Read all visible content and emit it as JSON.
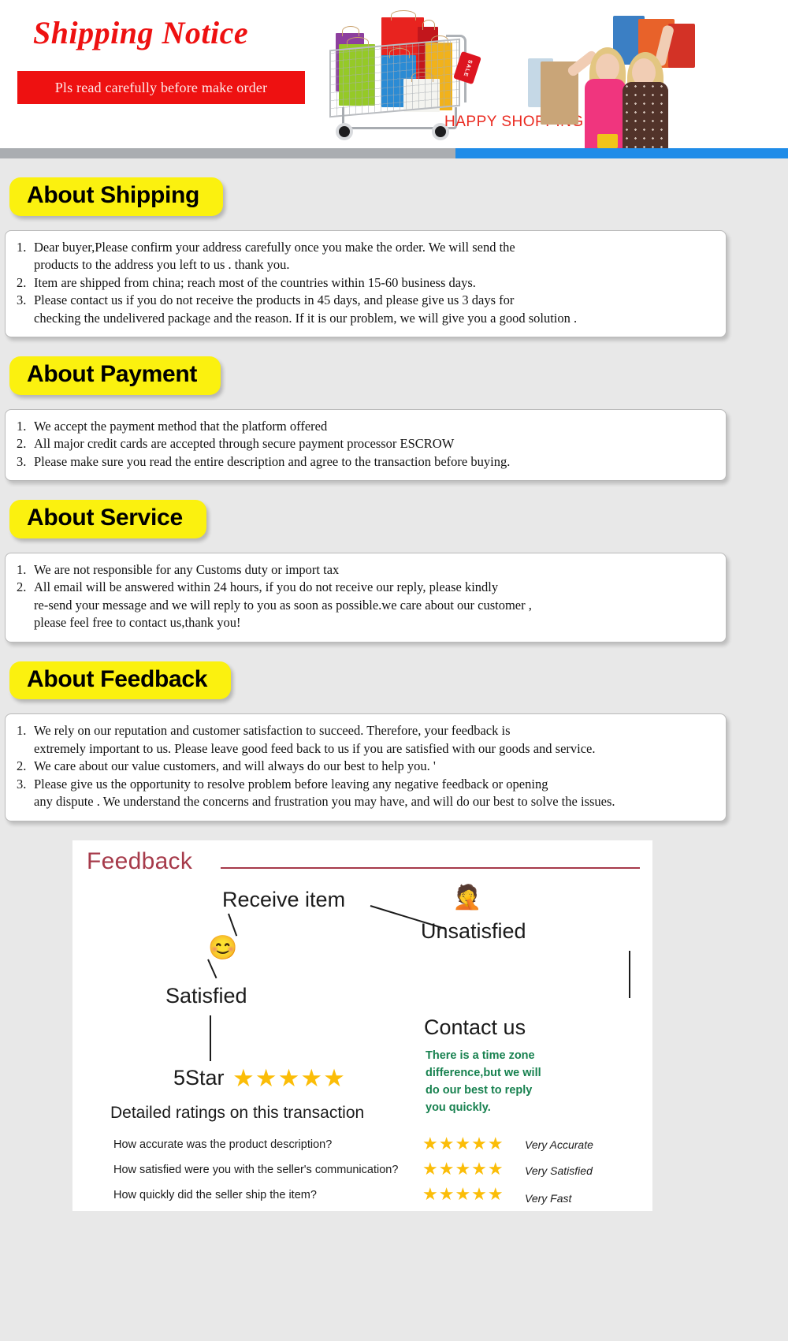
{
  "header": {
    "title": "Shipping Notice",
    "banner": "Pls read carefully before make order",
    "happy_shopping": "HAPPY SHOPPING",
    "sale_tag": "SALE",
    "colors": {
      "title": "#ee1111",
      "banner_bg": "#ee1111",
      "happy": "#ea2a20"
    }
  },
  "divider": {
    "left_color": "#aaadb1",
    "right_color": "#1f8ce8"
  },
  "theme": {
    "page_bg": "#e8e8e8",
    "badge_bg": "#fbf10f",
    "panel_bg": "#ffffff",
    "accent_maroon": "#a63a4a",
    "accent_green": "#17814f",
    "star_color": "#fbbd08"
  },
  "sections": [
    {
      "badge": "About Shipping",
      "items": [
        {
          "num": "1.",
          "text": "Dear buyer,Please confirm your address carefully once you make the order. We will send the\nproducts to the address you left to us . thank you."
        },
        {
          "num": "2.",
          "text": "Item are shipped from china; reach most of the countries within 15-60 business days."
        },
        {
          "num": "3.",
          "text": "Please contact us if you do not receive the products in 45 days, and please give us 3 days for\nchecking the undelivered package and the reason. If it is our problem, we will give you a good solution ."
        }
      ]
    },
    {
      "badge": "About Payment",
      "items": [
        {
          "num": "1.",
          "text": "We accept the payment method that the platform offered"
        },
        {
          "num": "2.",
          "text": "All major credit cards are accepted through secure payment processor ESCROW"
        },
        {
          "num": "3.",
          "text": "Please make sure you read the entire description and agree to the transaction before buying."
        }
      ]
    },
    {
      "badge": "About Service",
      "items": [
        {
          "num": "1.",
          "text": "We are not responsible for any Customs duty or import tax"
        },
        {
          "num": "2.",
          "text": "All email will be answered within 24 hours, if you do not receive our reply, please kindly\nre-send your message and we will reply to you as soon as possible.we care about our customer ,\nplease feel free to contact us,thank you!"
        }
      ]
    },
    {
      "badge": "About Feedback",
      "items": [
        {
          "num": "1.",
          "text": "We rely on our reputation and customer satisfaction to succeed. Therefore, your feedback is\nextremely important to us. Please leave good feed back to us if you are satisfied with our goods and service."
        },
        {
          "num": "2.",
          "text": "We care about our value customers, and will always do our best to help you. '"
        },
        {
          "num": "3.",
          "text": "Please give us the opportunity to resolve problem before leaving any negative feedback or opening\nany dispute . We understand the concerns and frustration you may have, and will do our best to solve the issues."
        }
      ]
    }
  ],
  "feedback_diagram": {
    "title": "Feedback",
    "receive_item": "Receive item",
    "satisfied": "Satisfied",
    "unsatisfied": "Unsatisfied",
    "satisfied_emoji": "😊",
    "unsatisfied_emoji": "🤦",
    "five_star_label": "5Star",
    "five_stars": "★★★★★",
    "contact_us": "Contact us",
    "contact_note": "There is a time zone\ndifference,but we will\ndo our best to reply\nyou quickly.",
    "detailed_heading": "Detailed ratings on this transaction",
    "ratings": [
      {
        "question": "How accurate was the product description?",
        "stars": "★★★★★",
        "label": "Very Accurate"
      },
      {
        "question": "How satisfied were you with the seller's communication?",
        "stars": "★★★★★",
        "label": "Very Satisfied"
      },
      {
        "question": "How quickly did the seller ship the item?",
        "stars": "★★★★★",
        "label": "Very Fast"
      }
    ]
  }
}
